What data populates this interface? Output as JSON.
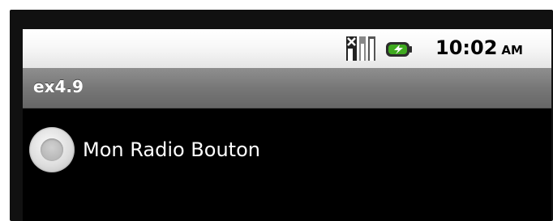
{
  "status_bar": {
    "time": "10:02",
    "ampm": "AM",
    "icons": [
      "no-signal-icon",
      "battery-charging-icon"
    ]
  },
  "app": {
    "title": "ex4.9"
  },
  "radio_button": {
    "label": "Mon Radio Bouton",
    "checked": false
  },
  "colors": {
    "screen_background": "#000000",
    "status_bar": "#f5f5f5",
    "title_bar": "#777777",
    "battery_green": "#3faa1f"
  }
}
